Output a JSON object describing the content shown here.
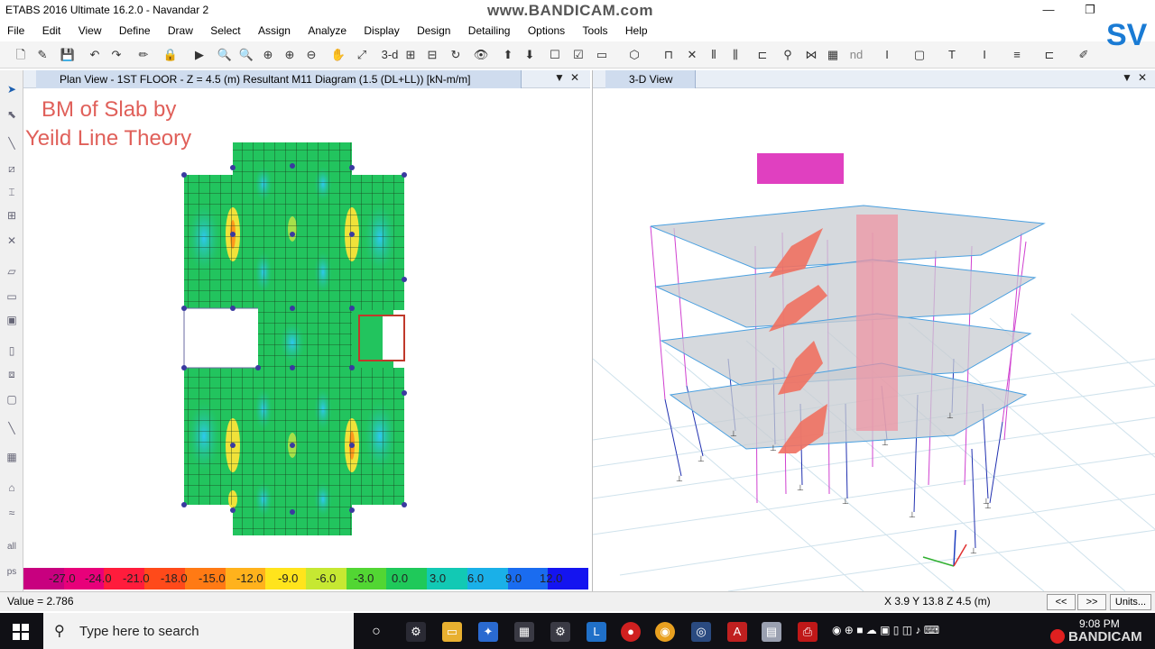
{
  "window": {
    "title": "ETABS 2016 Ultimate 16.2.0 - Navandar 2",
    "watermark_top": "www.BANDICAM.com",
    "minimize_glyph": "—",
    "restore_glyph": "❐"
  },
  "menu": [
    "File",
    "Edit",
    "View",
    "Define",
    "Draw",
    "Select",
    "Assign",
    "Analyze",
    "Display",
    "Design",
    "Detailing",
    "Options",
    "Tools",
    "Help"
  ],
  "toolbar": {
    "text_3d": "3-d",
    "text_nd": "nd"
  },
  "left_panel": {
    "tab_label": "Plan View - 1ST FLOOR - Z = 4.5 (m)   Resultant M11 Diagram   (1.5 (DL+LL))  [kN-m/m]",
    "overlay_line1": "BM of Slab by",
    "overlay_line2": "Yeild Line Theory",
    "legend_labels": [
      "-27.0",
      "-24.0",
      "-21.0",
      "-18.0",
      "-15.0",
      "-12.0",
      "-9.0",
      "-6.0",
      "-3.0",
      "0.0",
      "3.0",
      "6.0",
      "9.0",
      "12.0"
    ],
    "legend_colors": [
      "#c8007f",
      "#e8007a",
      "#ff1c3c",
      "#ff4a1a",
      "#ff7a14",
      "#ffb21c",
      "#ffe41c",
      "#c6e832",
      "#52d633",
      "#1fc95a",
      "#12c9b4",
      "#1ab0e8",
      "#1a6cf0",
      "#1414f0"
    ]
  },
  "right_panel": {
    "tab_label": "3-D View",
    "logo_text": "SV"
  },
  "panel_ctrl": {
    "dropdown": "▼",
    "close": "✕"
  },
  "status": {
    "value": "Value = 2.786",
    "coords": "X 3.9  Y 13.8  Z 4.5 (m)",
    "prev": "<<",
    "next": ">>",
    "units": "Units..."
  },
  "taskbar": {
    "search_placeholder": "Type here to search",
    "time": "9:08 PM",
    "watermark_bottom": "BANDICAM"
  }
}
